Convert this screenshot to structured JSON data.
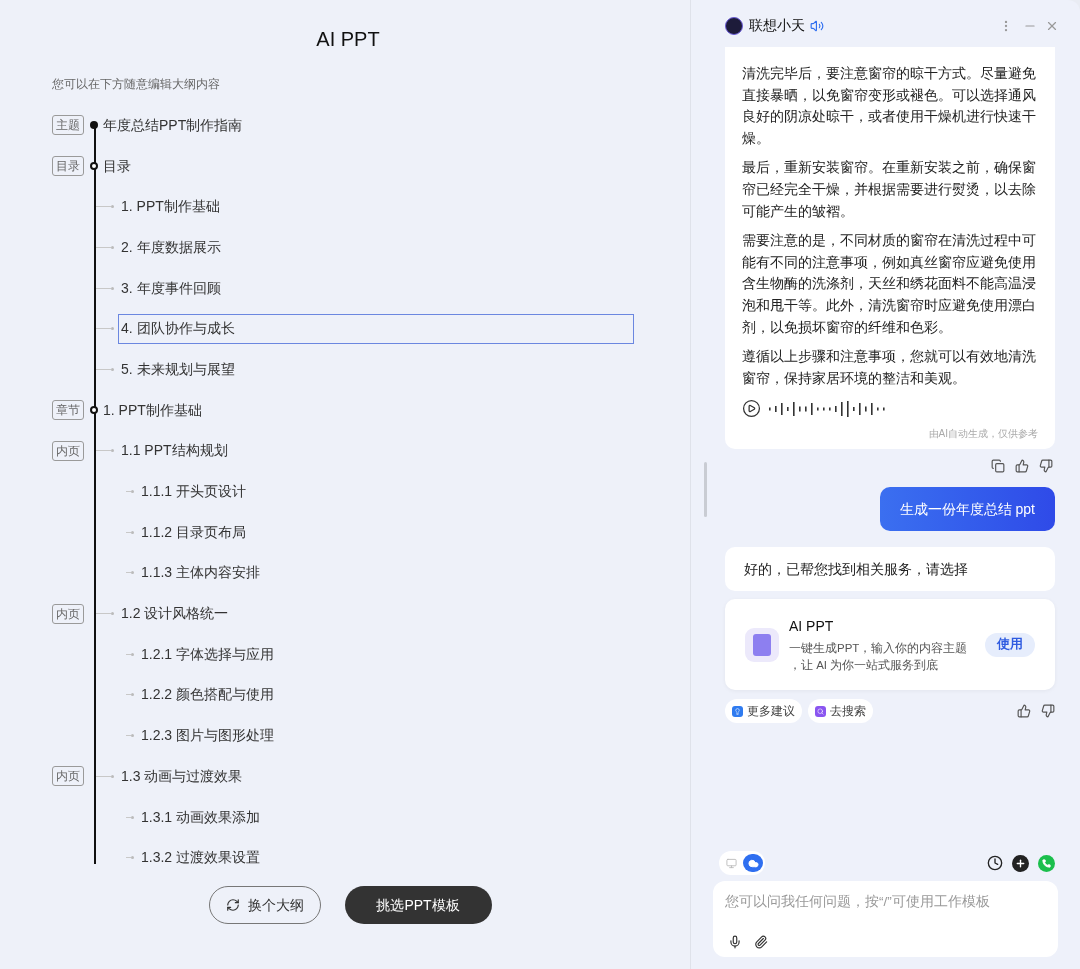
{
  "outline_panel": {
    "title": "AI PPT",
    "subtitle": "您可以在下方随意编辑大纲内容",
    "items": [
      {
        "tag": "主题",
        "text": "年度总结PPT制作指南",
        "kind": "title",
        "selected": false
      },
      {
        "tag": "目录",
        "text": "目录",
        "kind": "section",
        "selected": false,
        "children": [
          {
            "text": "1. PPT制作基础",
            "selected": false
          },
          {
            "text": "2. 年度数据展示",
            "selected": false
          },
          {
            "text": "3. 年度事件回顾",
            "selected": false
          },
          {
            "text": "4. 团队协作与成长",
            "selected": true
          },
          {
            "text": "5. 未来规划与展望",
            "selected": false
          }
        ]
      },
      {
        "tag": "章节",
        "text": "1. PPT制作基础",
        "kind": "section",
        "selected": false,
        "children": [
          {
            "tag": "内页",
            "text": "1.1 PPT结构规划",
            "selected": false,
            "children": [
              {
                "text": "1.1.1 开头页设计",
                "selected": false
              },
              {
                "text": "1.1.2 目录页布局",
                "selected": false
              },
              {
                "text": "1.1.3 主体内容安排",
                "selected": false
              }
            ]
          },
          {
            "tag": "内页",
            "text": "1.2 设计风格统一",
            "selected": false,
            "children": [
              {
                "text": "1.2.1 字体选择与应用",
                "selected": false
              },
              {
                "text": "1.2.2 颜色搭配与使用",
                "selected": false
              },
              {
                "text": "1.2.3 图片与图形处理",
                "selected": false
              }
            ]
          },
          {
            "tag": "内页",
            "text": "1.3 动画与过渡效果",
            "selected": false,
            "children": [
              {
                "text": "1.3.1 动画效果添加",
                "selected": false
              },
              {
                "text": "1.3.2 过渡效果设置",
                "selected": false
              }
            ]
          }
        ]
      }
    ],
    "buttons": [
      {
        "label": "换个大纲",
        "kind": "outline"
      },
      {
        "label": "挑选PPT模板",
        "kind": "primary"
      }
    ]
  },
  "assistant_panel": {
    "title": "联想小天",
    "messages": [
      {
        "kind": "answer",
        "paragraphs": [
          "清洗完毕后，要注意窗帘的晾干方式。尽量避免直接暴晒，以免窗帘变形或褪色。可以选择通风良好的阴凉处晾干，或者使用干燥机进行快速干燥。",
          "最后，重新安装窗帘。在重新安装之前，确保窗帘已经完全干燥，并根据需要进行熨烫，以去除可能产生的皱褶。",
          "需要注意的是，不同材质的窗帘在清洗过程中可能有不同的注意事项，例如真丝窗帘应避免使用含生物酶的洗涤剂，天丝和绣花面料不能高温浸泡和甩干等。此外，清洗窗帘时应避免使用漂白剂，以免损坏窗帘的纤维和色彩。",
          "遵循以上步骤和注意事项，您就可以有效地清洗窗帘，保持家居环境的整洁和美观。"
        ],
        "footnote": "由AI自动生成，仅供参考"
      },
      {
        "kind": "user",
        "text": "生成一份年度总结 ppt"
      },
      {
        "kind": "reply",
        "text": "好的，已帮您找到相关服务，请选择"
      },
      {
        "kind": "service",
        "title": "AI PPT",
        "description_lines": [
          "一键生成PPT，输入你的内容主题",
          "，让 AI 为你一站式服务到底"
        ],
        "action": "使用"
      }
    ],
    "suggestions": [
      {
        "label": "更多建议",
        "color": "#2f7bf0"
      },
      {
        "label": "去搜索",
        "color": "#8a55f0"
      }
    ],
    "mode_toggle": [
      {
        "kind": "local",
        "selected": false
      },
      {
        "kind": "cloud",
        "selected": true
      }
    ],
    "input": {
      "placeholder": "您可以问我任何问题，按“/”可使用工作模板"
    }
  }
}
